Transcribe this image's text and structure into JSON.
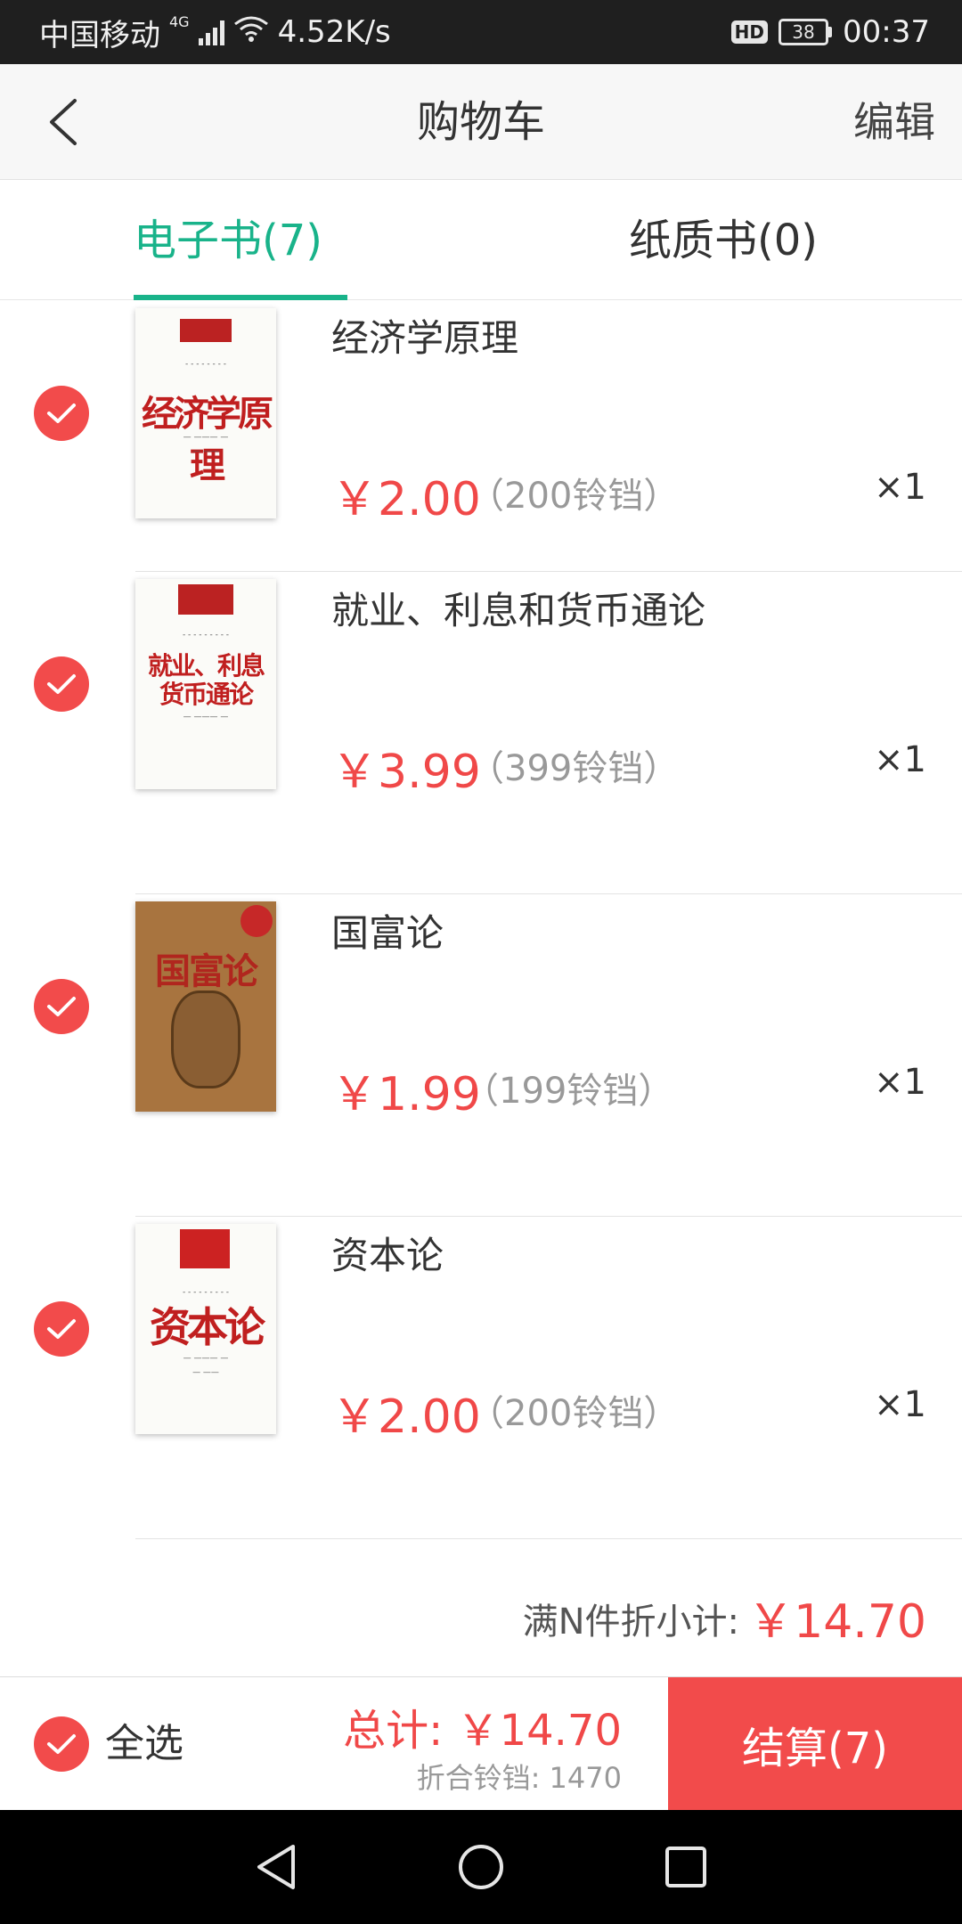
{
  "status_bar": {
    "carrier": "中国移动",
    "network": "4G",
    "speed": "4.52K/s",
    "hd": "HD",
    "battery": "38",
    "time": "00:37"
  },
  "nav": {
    "title": "购物车",
    "edit": "编辑"
  },
  "tabs": [
    {
      "label": "电子书(7)",
      "active": true
    },
    {
      "label": "纸质书(0)",
      "active": false
    }
  ],
  "items": [
    {
      "title": "经济学原理",
      "price": "￥2.00",
      "coins": "（200铃铛）",
      "qty": "×1",
      "checked": true
    },
    {
      "title": "就业、利息和货币通论",
      "price": "￥3.99",
      "coins": "（399铃铛）",
      "qty": "×1",
      "checked": true
    },
    {
      "title": "国富论",
      "price": "￥1.99",
      "coins": "（199铃铛）",
      "qty": "×1",
      "checked": true
    },
    {
      "title": "资本论",
      "price": "￥2.00",
      "coins": "（200铃铛）",
      "qty": "×1",
      "checked": true
    }
  ],
  "subtotal": {
    "label": "满N件折小计:",
    "value": "￥14.70"
  },
  "bottom": {
    "select_all": "全选",
    "total": "总计: ￥14.70",
    "coin_total": "折合铃铛: 1470",
    "checkout": "结算(7)"
  },
  "colors": {
    "accent_green": "#19b38a",
    "accent_red": "#f24b4b"
  }
}
